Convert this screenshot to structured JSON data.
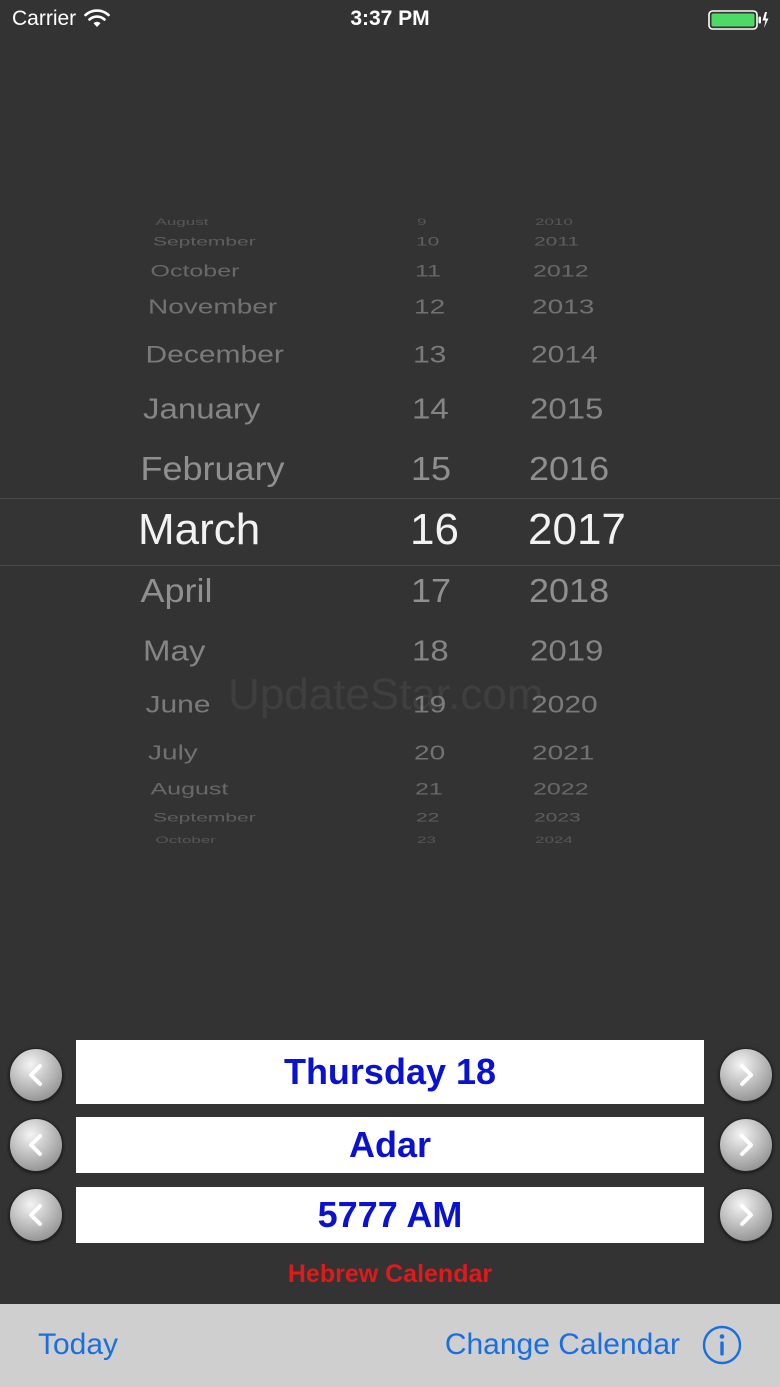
{
  "status_bar": {
    "carrier": "Carrier",
    "time": "3:37 PM",
    "wifi_icon": "wifi-icon",
    "battery_icon": "battery-icon",
    "battery_color": "#4cd964"
  },
  "picker": {
    "rows": [
      {
        "month": "August",
        "day": "9",
        "year": "2010"
      },
      {
        "month": "September",
        "day": "10",
        "year": "2011"
      },
      {
        "month": "October",
        "day": "11",
        "year": "2012"
      },
      {
        "month": "November",
        "day": "12",
        "year": "2013"
      },
      {
        "month": "December",
        "day": "13",
        "year": "2014"
      },
      {
        "month": "January",
        "day": "14",
        "year": "2015"
      },
      {
        "month": "February",
        "day": "15",
        "year": "2016"
      },
      {
        "month": "March",
        "day": "16",
        "year": "2017"
      },
      {
        "month": "April",
        "day": "17",
        "year": "2018"
      },
      {
        "month": "May",
        "day": "18",
        "year": "2019"
      },
      {
        "month": "June",
        "day": "19",
        "year": "2020"
      },
      {
        "month": "July",
        "day": "20",
        "year": "2021"
      },
      {
        "month": "August",
        "day": "21",
        "year": "2022"
      },
      {
        "month": "September",
        "day": "22",
        "year": "2023"
      },
      {
        "month": "October",
        "day": "23",
        "year": "2024"
      }
    ],
    "selected_index": 7,
    "watermark": "UpdateStar.com"
  },
  "date_rows": [
    {
      "value": "Thursday 18"
    },
    {
      "value": "Adar"
    },
    {
      "value": "5777 AM"
    }
  ],
  "calendar_label": "Hebrew Calendar",
  "toolbar": {
    "today_label": "Today",
    "change_calendar_label": "Change Calendar",
    "info_icon": "info-icon"
  },
  "colors": {
    "background": "#333333",
    "date_text": "#0a12cf",
    "calendar_label": "#e0191b",
    "toolbar_link": "#1a6fe0",
    "toolbar_bg": "#cfcfcf"
  }
}
